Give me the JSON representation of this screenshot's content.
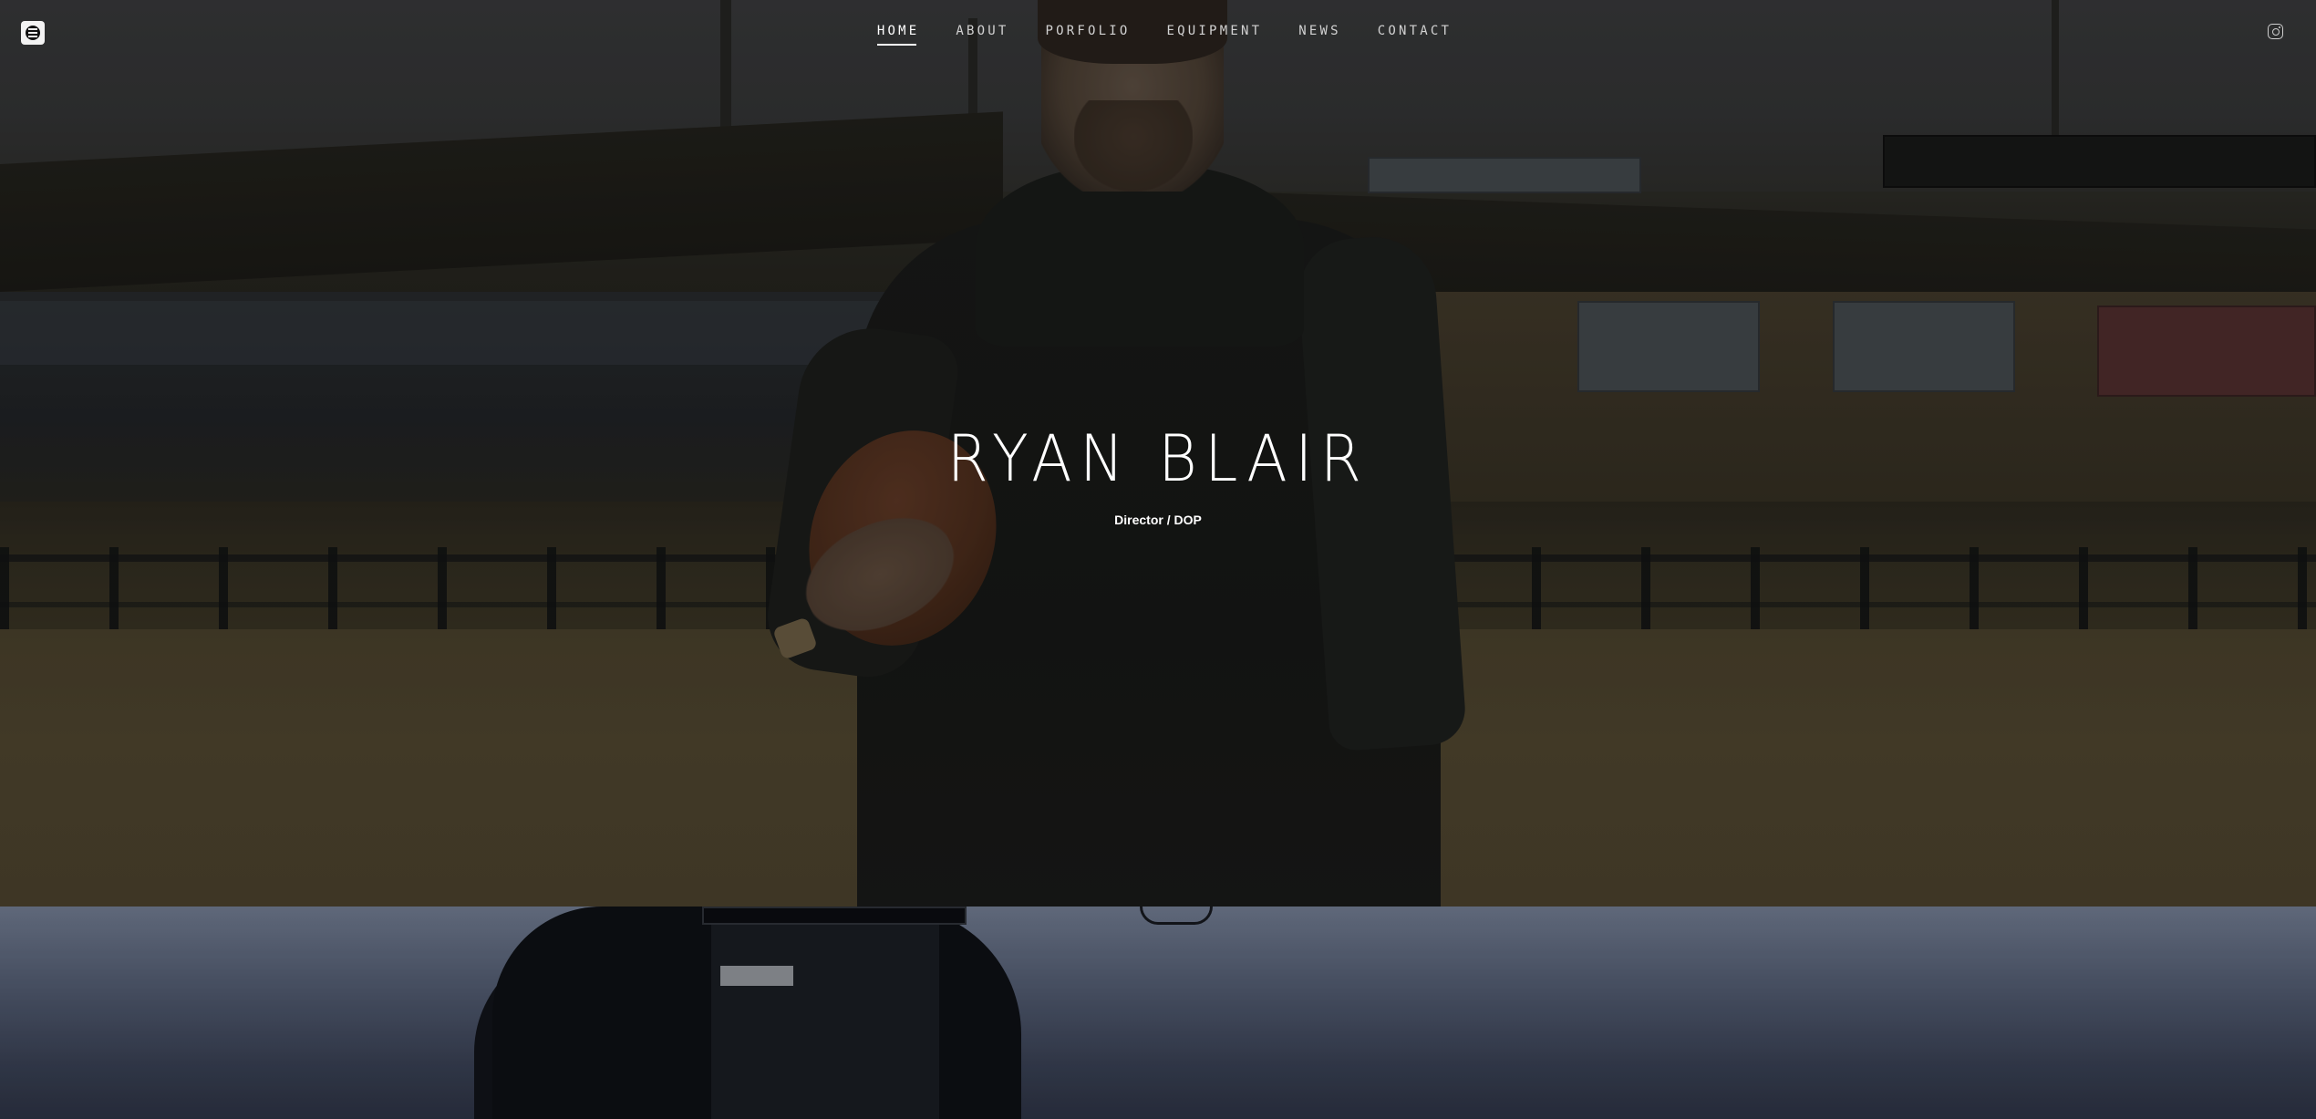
{
  "nav": {
    "logo": "logo-icon",
    "items": [
      {
        "label": "HOME",
        "active": true
      },
      {
        "label": "ABOUT",
        "active": false
      },
      {
        "label": "PORFOLIO",
        "active": false
      },
      {
        "label": "EQUIPMENT",
        "active": false
      },
      {
        "label": "NEWS",
        "active": false
      },
      {
        "label": "CONTACT",
        "active": false
      }
    ],
    "social_icon": "instagram-icon"
  },
  "hero": {
    "title": "RYAN BLAIR",
    "subtitle": "Director / DOP"
  },
  "colors": {
    "nav_text": "#d2d2d2",
    "nav_active": "#ffffff",
    "title": "#ffffff"
  }
}
